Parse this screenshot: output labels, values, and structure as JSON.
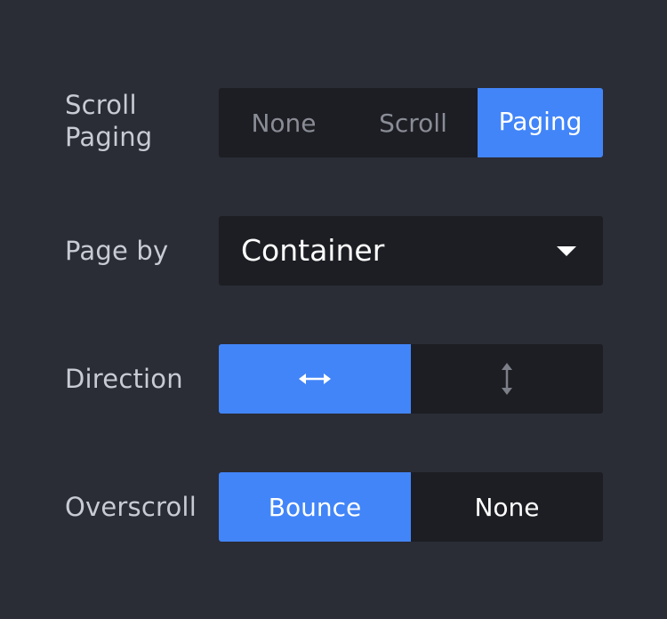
{
  "scroll_paging": {
    "label_line1": "Scroll",
    "label_line2": "Paging",
    "options": [
      "None",
      "Scroll",
      "Paging"
    ],
    "selected": "Paging"
  },
  "page_by": {
    "label": "Page by",
    "value": "Container"
  },
  "direction": {
    "label": "Direction",
    "options": [
      "horizontal-arrows-icon",
      "vertical-arrows-icon"
    ],
    "selected": "horizontal-arrows-icon"
  },
  "overscroll": {
    "label": "Overscroll",
    "options": [
      "Bounce",
      "None"
    ],
    "selected": "Bounce"
  },
  "colors": {
    "background": "#2a2c36",
    "control": "#1c1e23",
    "accent": "#4285f8"
  }
}
